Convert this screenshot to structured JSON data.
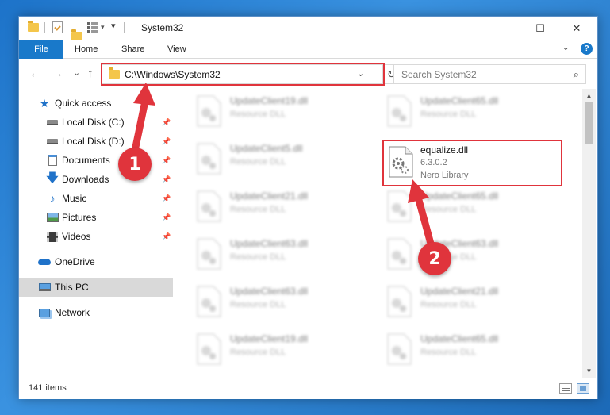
{
  "window": {
    "title": "System32",
    "controls": {
      "minimize": "—",
      "maximize": "☐",
      "close": "✕"
    }
  },
  "ribbon": {
    "tabs": [
      "File",
      "Home",
      "Share",
      "View"
    ],
    "help": "?",
    "expand": "⌄"
  },
  "navigation": {
    "back": "←",
    "forward": "→",
    "recent": "⌄",
    "up": "↑",
    "address": "C:\\Windows\\System32",
    "address_dropdown": "⌄",
    "refresh": "↻",
    "search_placeholder": "Search System32",
    "search_icon": "⌕"
  },
  "sidebar": {
    "items": [
      {
        "label": "Quick access",
        "icon": "star-icon",
        "pinned": false,
        "selected": false
      },
      {
        "label": "Local Disk (C:)",
        "icon": "drive-icon",
        "pinned": true,
        "selected": false
      },
      {
        "label": "Local Disk (D:)",
        "icon": "drive-icon",
        "pinned": true,
        "selected": false
      },
      {
        "label": "Documents",
        "icon": "documents-icon",
        "pinned": true,
        "selected": false
      },
      {
        "label": "Downloads",
        "icon": "download-icon",
        "pinned": true,
        "selected": false
      },
      {
        "label": "Music",
        "icon": "music-icon",
        "pinned": true,
        "selected": false
      },
      {
        "label": "Pictures",
        "icon": "pictures-icon",
        "pinned": true,
        "selected": false
      },
      {
        "label": "Videos",
        "icon": "videos-icon",
        "pinned": true,
        "selected": false
      },
      {
        "label": "OneDrive",
        "icon": "cloud-icon",
        "pinned": false,
        "selected": false
      },
      {
        "label": "This PC",
        "icon": "computer-icon",
        "pinned": false,
        "selected": true
      },
      {
        "label": "Network",
        "icon": "network-icon",
        "pinned": false,
        "selected": false
      }
    ]
  },
  "files": [
    {
      "name": "UpdateClient19.dll",
      "type": "Resource DLL"
    },
    {
      "name": "UpdateClient65.dll",
      "type": "Resource DLL"
    },
    {
      "name": "UpdateClient5.dll",
      "type": "Resource DLL"
    },
    {
      "name": "equalize.dll",
      "type": "6.3.0.2",
      "extra": "Nero Library"
    },
    {
      "name": "UpdateClient21.dll",
      "type": "Resource DLL"
    },
    {
      "name": "UpdateClient65.dll",
      "type": "Resource DLL"
    },
    {
      "name": "UpdateClient63.dll",
      "type": "Resource DLL"
    },
    {
      "name": "UpdateClient63.dll",
      "type": "Resource DLL"
    },
    {
      "name": "UpdateClient63.dll",
      "type": "Resource DLL"
    },
    {
      "name": "UpdateClient21.dll",
      "type": "Resource DLL"
    },
    {
      "name": "UpdateClient19.dll",
      "type": "Resource DLL"
    },
    {
      "name": "UpdateClient65.dll",
      "type": "Resource DLL"
    }
  ],
  "status": {
    "item_count": "141 items"
  },
  "annotations": {
    "step1": "1",
    "step2": "2",
    "color": "#e0343c"
  }
}
